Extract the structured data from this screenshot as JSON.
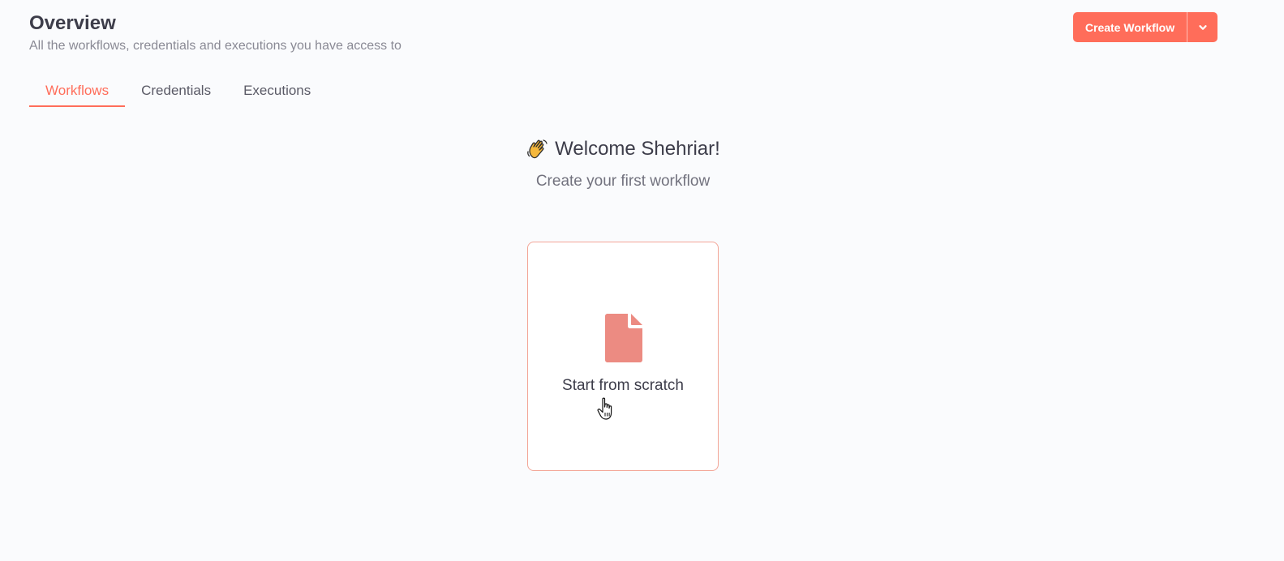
{
  "header": {
    "title": "Overview",
    "subtitle": "All the workflows, credentials and executions you have access to"
  },
  "actions": {
    "create_label": "Create Workflow",
    "dropdown_icon": "chevron-down-icon"
  },
  "tabs": [
    {
      "label": "Workflows",
      "active": true
    },
    {
      "label": "Credentials",
      "active": false
    },
    {
      "label": "Executions",
      "active": false
    }
  ],
  "welcome": {
    "title": "Welcome Shehriar!",
    "subtitle": "Create your first workflow",
    "icon": "waving-hand-icon"
  },
  "scratch_card": {
    "label": "Start from scratch",
    "icon": "file-icon"
  },
  "colors": {
    "accent": "#ff6d5a",
    "doc_icon": "#ec8b82",
    "card_border": "#f3a597"
  }
}
